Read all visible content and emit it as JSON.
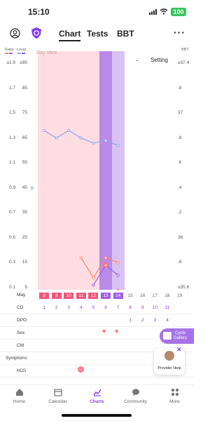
{
  "status": {
    "time": "15:10",
    "battery": "100"
  },
  "nav": {
    "tabs": [
      "Chart",
      "Tests",
      "BBT"
    ],
    "active_tab": "Chart"
  },
  "chart": {
    "ratio_header": "Ratio",
    "level_header": "Level",
    "bbt_header": "BBT",
    "day_view": "Day View",
    "setting_label": "Setting",
    "ratio_ticks": [
      "≥1.9",
      "1.7",
      "1.5",
      "1.3",
      "1.1",
      "0.9",
      "0.7",
      "0.5",
      "0.3",
      "0.1"
    ],
    "level_ticks": [
      "≥95",
      "85",
      "75",
      "65",
      "55",
      "45",
      "35",
      "25",
      "15",
      "5"
    ],
    "bbt_ticks": [
      "≥37.4",
      ".8",
      "37",
      ".8",
      ".6",
      ".4",
      ".2",
      "36",
      ".8",
      "≤35.6"
    ],
    "month_label": "May",
    "dates": [
      "8",
      "9",
      "10",
      "11",
      "12",
      "13",
      "14",
      "15",
      "16",
      "17",
      "18",
      "19"
    ],
    "today_index": 6,
    "colors": {
      "fertile_bg": "#ffdde2",
      "peak_bg": "#b98ae8",
      "ovulation_bg": "#d9c2f2",
      "lh_line": "#8fa4ef",
      "e3g_line": "#f7866c",
      "pdg_line": "#a05ce6"
    }
  },
  "chart_data": {
    "type": "line",
    "x": [
      "May 8",
      "May 9",
      "May 10",
      "May 11",
      "May 12",
      "May 13",
      "May 14"
    ],
    "series": [
      {
        "values": [
          null,
          68,
          65,
          68,
          65,
          63,
          64,
          62
        ]
      },
      {
        "values": [
          null,
          null,
          null,
          null,
          17,
          9,
          17,
          15
        ]
      },
      {
        "values": [
          null,
          null,
          null,
          null,
          null,
          6,
          14,
          10
        ]
      }
    ],
    "ylim": [
      5,
      95
    ]
  },
  "rows": {
    "cd_label": "CD",
    "cd_values": [
      "1",
      "2",
      "3",
      "4",
      "5",
      "6",
      "7",
      "8",
      "9",
      "10",
      "11"
    ],
    "dpo_label": "DPO",
    "dpo_values": [
      "1",
      "2",
      "3",
      "4"
    ],
    "sex_label": "Sex",
    "cm_label": "CM",
    "symptoms_label": "Symptoms",
    "hcg_label": "hCG",
    "hcg_mark": "−"
  },
  "cycle_gallery": {
    "line1": "Cycle",
    "line2": "Gallery"
  },
  "provider_help": "Provider Help",
  "bottom_nav": [
    "Home",
    "Calendar",
    "Charts",
    "Community",
    "More"
  ],
  "bottom_nav_active": "Charts"
}
